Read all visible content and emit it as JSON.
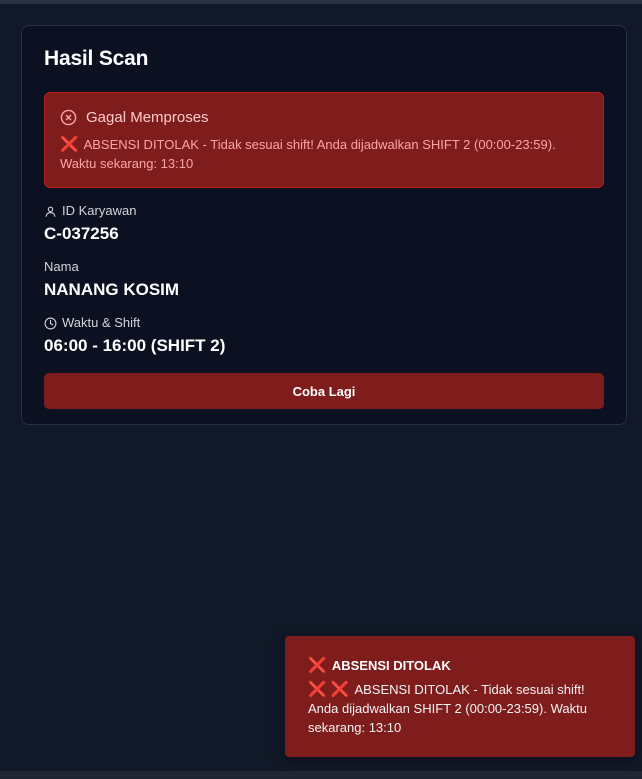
{
  "card": {
    "title": "Hasil Scan"
  },
  "alert": {
    "title": "Gagal Memproses",
    "icon": "x-circle-icon",
    "message_icon": "❌",
    "message": "ABSENSI DITOLAK - Tidak sesuai shift! Anda dijadwalkan SHIFT 2 (00:00-23:59). Waktu sekarang: 13:10"
  },
  "fields": {
    "employee_id": {
      "label": "ID Karyawan",
      "icon": "user-icon",
      "value": "C-037256"
    },
    "name": {
      "label": "Nama",
      "value": "NANANG KOSIM"
    },
    "time_shift": {
      "label": "Waktu & Shift",
      "icon": "clock-icon",
      "value": "06:00 - 16:00 (SHIFT 2)"
    }
  },
  "retry_button": {
    "label": "Coba Lagi"
  },
  "toast": {
    "title_icon": "❌",
    "title": "ABSENSI DITOLAK",
    "message_icons": "❌ ❌",
    "message": "ABSENSI DITOLAK - Tidak sesuai shift! Anda dijadwalkan SHIFT 2 (00:00-23:59). Waktu sekarang: 13:10"
  },
  "colors": {
    "background": "#111827",
    "card": "#0b1120",
    "danger": "#7f1d1d",
    "danger_border": "#b91c1c",
    "cross": "#f43f5e"
  }
}
